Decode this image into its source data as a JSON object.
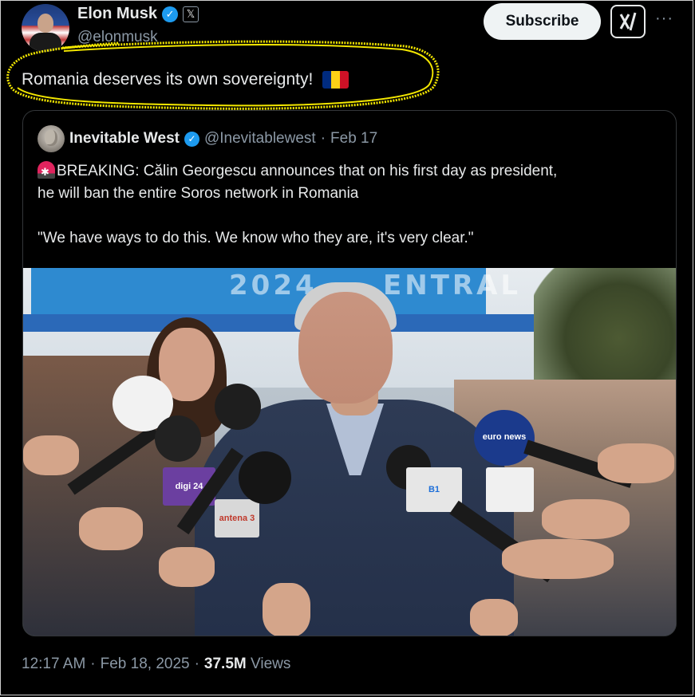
{
  "author": {
    "name": "Elon Musk",
    "handle": "@elonmusk",
    "x_badge": "𝕏"
  },
  "actions": {
    "subscribe_label": "Subscribe",
    "grok_label": "𝕏/",
    "more_label": "···"
  },
  "tweet": {
    "text": "Romania deserves its own sovereignty!",
    "flag_colors": [
      "#002B7F",
      "#FCD116",
      "#CE1126"
    ]
  },
  "quoted": {
    "name": "Inevitable West",
    "handle": "@Inevitablewest",
    "separator": "·",
    "date": "Feb 17",
    "line1": "BREAKING: Călin Georgescu announces that on his first day as president,",
    "line2": "he will ban the entire Soros network in Romania",
    "quote": "\"We have ways to do this. We know who they are, it's very clear.\"",
    "photo": {
      "banner_text": "2024 ... ENTRAL",
      "mic_labels": [
        "euro news",
        "digi 24",
        "antena 3",
        "B1"
      ]
    }
  },
  "footer": {
    "time": "12:17 AM",
    "sep1": "·",
    "date": "Feb 18, 2025",
    "sep2": "·",
    "views_count": "37.5M",
    "views_label": "Views"
  },
  "colors": {
    "accent_blue": "#1d9bf0",
    "highlight_yellow": "#f2e600",
    "background": "#000000"
  }
}
